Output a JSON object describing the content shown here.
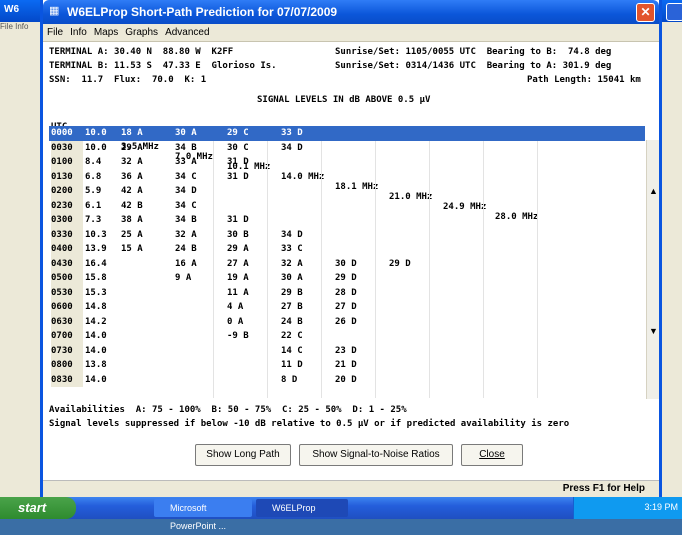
{
  "bg": {
    "title": "W6",
    "menu": "File  Info"
  },
  "window": {
    "title": "W6ELProp Short-Path Prediction for 07/07/2009"
  },
  "menu": [
    "File",
    "Info",
    "Maps",
    "Graphs",
    "Advanced"
  ],
  "header": {
    "line1": "TERMINAL A: 30.40 N  88.80 W  K2FF",
    "line1r": "Sunrise/Set: 1105/0055 UTC  Bearing to B:  74.8 deg",
    "line2": "TERMINAL B: 11.53 S  47.33 E  Glorioso Is.",
    "line2r": "Sunrise/Set: 0314/1436 UTC  Bearing to A: 301.9 deg",
    "line3": "SSN:  11.7  Flux:  70.0  K: 1",
    "line3r": "Path Length: 15041 km",
    "signal_title": "SIGNAL LEVELS IN dB ABOVE 0.5 µV"
  },
  "columns": [
    "UTC",
    "MUF",
    "3.5 MHz",
    "7.0 MHz",
    "10.1 MHz",
    "14.0 MHz",
    "18.1 MHz",
    "21.0 MHz",
    "24.9 MHz",
    "28.0 MHz"
  ],
  "rows": [
    [
      "0000",
      "10.0",
      "18 A",
      "30 A",
      "29 C",
      "33 D",
      "",
      "",
      "",
      ""
    ],
    [
      "0030",
      "10.0",
      "29 A",
      "34 B",
      "30 C",
      "34 D",
      "",
      "",
      "",
      ""
    ],
    [
      "0100",
      "8.4",
      "32 A",
      "33 A",
      "31 D",
      "",
      "",
      "",
      "",
      ""
    ],
    [
      "0130",
      "6.8",
      "36 A",
      "34 C",
      "31 D",
      "",
      "",
      "",
      "",
      ""
    ],
    [
      "0200",
      "5.9",
      "42 A",
      "34 D",
      "",
      "",
      "",
      "",
      "",
      ""
    ],
    [
      "0230",
      "6.1",
      "42 B",
      "34 C",
      "",
      "",
      "",
      "",
      "",
      ""
    ],
    [
      "0300",
      "7.3",
      "38 A",
      "34 B",
      "31 D",
      "",
      "",
      "",
      "",
      ""
    ],
    [
      "0330",
      "10.3",
      "25 A",
      "32 A",
      "30 B",
      "34 D",
      "",
      "",
      "",
      ""
    ],
    [
      "0400",
      "13.9",
      "15 A",
      "24 B",
      "29 A",
      "33 C",
      "",
      "",
      "",
      ""
    ],
    [
      "0430",
      "16.4",
      "",
      "16 A",
      "27 A",
      "32 A",
      "30 D",
      "29 D",
      "",
      ""
    ],
    [
      "0500",
      "15.8",
      "",
      "9 A",
      "19 A",
      "30 A",
      "29 D",
      "",
      "",
      ""
    ],
    [
      "0530",
      "15.3",
      "",
      "",
      "11 A",
      "29 B",
      "28 D",
      "",
      "",
      ""
    ],
    [
      "0600",
      "14.8",
      "",
      "",
      "4 A",
      "27 B",
      "27 D",
      "",
      "",
      ""
    ],
    [
      "0630",
      "14.2",
      "",
      "",
      "0 A",
      "24 B",
      "26 D",
      "",
      "",
      ""
    ],
    [
      "0700",
      "14.0",
      "",
      "",
      "-9 B",
      "22 C",
      "",
      "",
      "",
      ""
    ],
    [
      "0730",
      "14.0",
      "",
      "",
      "",
      "14 C",
      "23 D",
      "",
      "",
      ""
    ],
    [
      "0800",
      "13.8",
      "",
      "",
      "",
      "11 D",
      "21 D",
      "",
      "",
      ""
    ],
    [
      "0830",
      "14.0",
      "",
      "",
      "",
      "8 D",
      "20 D",
      "",
      "",
      ""
    ]
  ],
  "footer": {
    "avail": "Availabilities  A: 75 - 100%  B: 50 - 75%  C: 25 - 50%  D: 1 - 25%",
    "note": "Signal levels suppressed if below -10 dB relative to 0.5 µV or if predicted availability is zero"
  },
  "buttons": {
    "long_path": "Show Long Path",
    "snr": "Show Signal-to-Noise Ratios",
    "close": "Close"
  },
  "status": "Press F1 for Help",
  "taskbar": {
    "start": "start",
    "ppt": "Microsoft PowerPoint ...",
    "app": "W6ELProp",
    "clock": "3:19 PM"
  }
}
